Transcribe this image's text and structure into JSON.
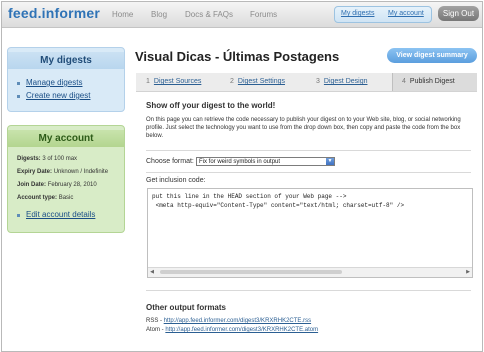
{
  "header": {
    "logo": "feed.informer",
    "nav": [
      "Home",
      "Blog",
      "Docs & FAQs",
      "Forums"
    ],
    "user_links": [
      "My digests",
      "My account"
    ],
    "signout": "Sign Out"
  },
  "sidebar": {
    "digests": {
      "title": "My digests",
      "links": [
        "Manage digests",
        "Create new digest"
      ]
    },
    "account": {
      "title": "My account",
      "rows": [
        {
          "label": "Digests:",
          "value": "3 of 100 max"
        },
        {
          "label": "Expiry Date:",
          "value": "Unknown / Indefinite"
        },
        {
          "label": "Join Date:",
          "value": "February 28, 2010"
        },
        {
          "label": "Account type:",
          "value": "Basic"
        }
      ],
      "edit_link": "Edit account details"
    }
  },
  "main": {
    "title": "Visual Dicas - Últimas Postagens",
    "view_button": "View digest summary",
    "tabs": [
      {
        "num": "1",
        "label": "Digest Sources"
      },
      {
        "num": "2",
        "label": "Digest Settings"
      },
      {
        "num": "3",
        "label": "Digest Design"
      },
      {
        "num": "4",
        "label": "Publish Digest"
      }
    ],
    "section_title": "Show off your digest to the world!",
    "description": "On this page you can retrieve the code necessary to publish your digest on to your Web site, blog, or social networking profile. Just select the technology you want to use from the drop down box, then copy and paste the code from the box below.",
    "choose_format_label": "Choose format:",
    "choose_format_value": "Fix for weird symbols in output",
    "inclusion_label": "Get inclusion code:",
    "code_lines": [
      "put this line in the HEAD section of your Web page -->",
      " <meta http-equiv=\"Content-Type\" content=\"text/html; charset=utf-8\" />"
    ],
    "other_title": "Other output formats",
    "feeds": [
      {
        "label": "RSS - ",
        "url": "http://app.feed.informer.com/digest3/KRXRHK2CTE.rss"
      },
      {
        "label": "Atom - ",
        "url": "http://app.feed.informer.com/digest3/KRXRHK2CTE.atom"
      }
    ]
  }
}
